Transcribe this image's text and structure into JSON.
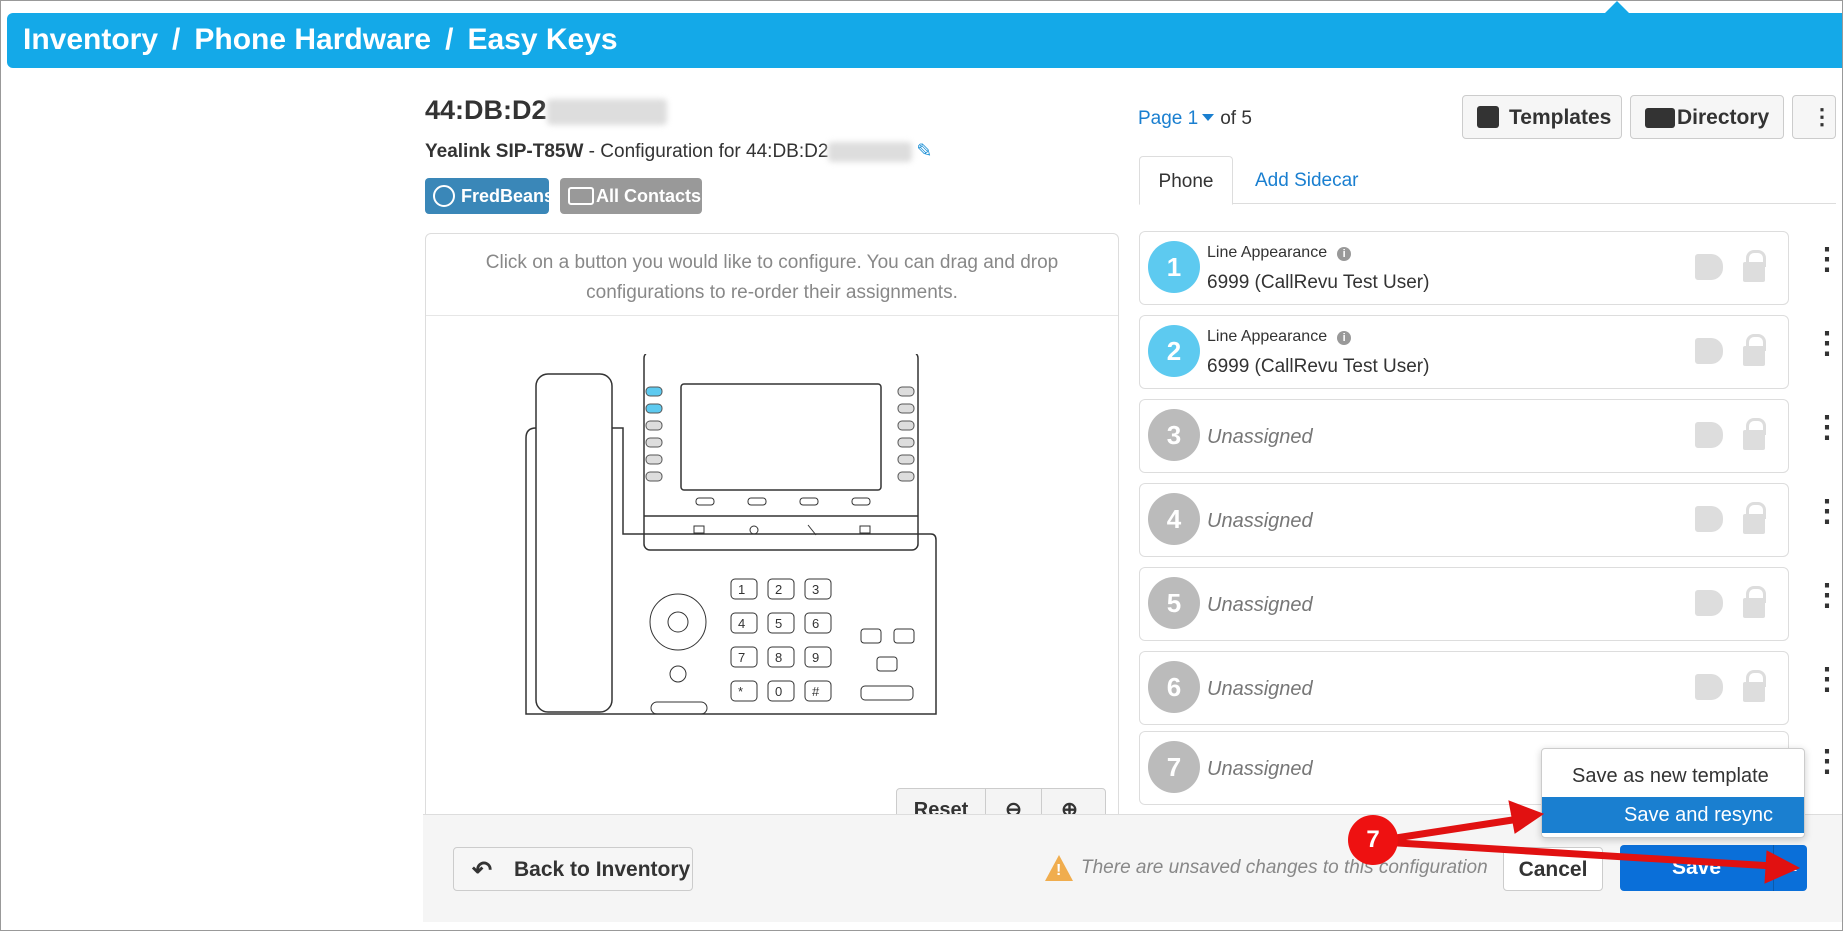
{
  "breadcrumb": {
    "items": [
      "Inventory",
      "Phone Hardware",
      "Easy Keys"
    ],
    "separator": "/"
  },
  "device": {
    "mac_prefix": "44:DB:D2",
    "model": "Yealink SIP-T85W",
    "config_text": " - Configuration for 44:DB:D2",
    "tags": [
      "FredBeans",
      "All Contacts"
    ]
  },
  "instructions": "Click on a button you would like to configure. You can drag and drop configurations to re-order their assignments.",
  "keypad": [
    "1",
    "2",
    "3",
    "4",
    "5",
    "6",
    "7",
    "8",
    "9",
    "*",
    "0",
    "#"
  ],
  "zoom_controls": {
    "reset": "Reset"
  },
  "pager": {
    "page_label": "Page",
    "current": "1",
    "of_label": "of",
    "total": "5"
  },
  "toolbar": {
    "templates": "Templates",
    "directory": "Directory"
  },
  "tabs": [
    "Phone",
    "Add Sidecar"
  ],
  "slots": [
    {
      "num": "1",
      "type": "Line Appearance",
      "label": "6999 (CallRevu Test User)",
      "assigned": true
    },
    {
      "num": "2",
      "type": "Line Appearance",
      "label": "6999 (CallRevu Test User)",
      "assigned": true
    },
    {
      "num": "3",
      "label": "Unassigned",
      "assigned": false
    },
    {
      "num": "4",
      "label": "Unassigned",
      "assigned": false
    },
    {
      "num": "5",
      "label": "Unassigned",
      "assigned": false
    },
    {
      "num": "6",
      "label": "Unassigned",
      "assigned": false
    },
    {
      "num": "7",
      "label": "Unassigned",
      "assigned": false
    }
  ],
  "footer": {
    "back_label": "Back to Inventory",
    "warning": "There are unsaved changes to this configuration",
    "cancel": "Cancel",
    "save": "Save"
  },
  "save_menu": {
    "items": [
      "Save as new template",
      "Save and resync"
    ],
    "active": "Save and resync"
  },
  "annotation": {
    "step": "7",
    "color": "#e11111"
  },
  "colors": {
    "topbar": "#14a9e8",
    "accent": "#1a7fd0",
    "line_key_blue": "#5dcaf0",
    "save_blue": "#0a6fd9"
  }
}
